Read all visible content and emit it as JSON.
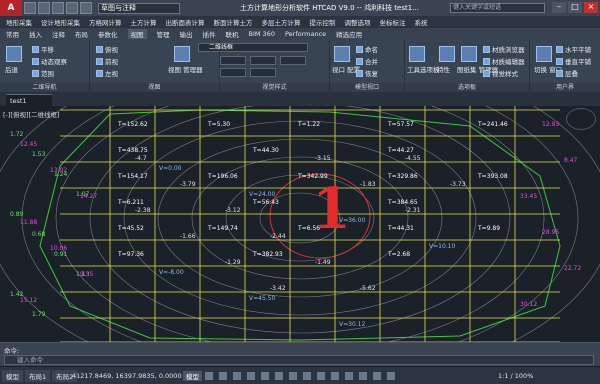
{
  "titlebar": {
    "logo": "A",
    "workspace": "草图与注释",
    "title": "土方计算地形分析软件 HTCAD V9.0 -- 鸿利科技    test1...",
    "search_placeholder": "键入关键字或短语"
  },
  "menubar": [
    "地形采集",
    "设计地形采集",
    "方格网计算",
    "土方计算",
    "出断面表计算",
    "断面计算土方",
    "多层土方计算",
    "提示控制",
    "调整选项",
    "坐标标注",
    "系统"
  ],
  "tabs": [
    "常用",
    "插入",
    "注释",
    "布局",
    "参数化",
    "视图",
    "管理",
    "输出",
    "插件",
    "联机",
    "BIM 360",
    "Performance",
    "精选应用"
  ],
  "ribbon": {
    "panels": [
      "二维导航",
      "视图",
      "视觉样式",
      "模型视口",
      "选项板",
      "用户界面"
    ],
    "nav": {
      "pan": "平移",
      "orbit": "动态观察",
      "extents": "范围",
      "back": "后退"
    },
    "views": [
      "俯视",
      "前视",
      "左视"
    ],
    "view_manager": "视图\n管理器",
    "layer_select": "二维线框",
    "viewport_btns": [
      "命名",
      "合并",
      "恢复"
    ],
    "viewport_config": "视口\n配置",
    "palette": {
      "toolbar": "工具选项板",
      "properties": "特性",
      "sheetset": "图纸集\n管理器"
    },
    "materials": [
      "材质浏览器",
      "材质编辑器",
      "视觉样式"
    ],
    "ui": {
      "switch": "切换\n窗口",
      "tile_h": "水平平铺",
      "tile_v": "垂直平铺",
      "cascade": "层叠",
      "user_interface": "用户界"
    }
  },
  "doc_tab": "test1",
  "canvas": {
    "viewport_label": "[-][俯视][二维线框]",
    "big_label": "1",
    "t_labels": [
      "T=152.62",
      "T=5.30",
      "T=1.22",
      "T=57.57",
      "T=241.46",
      "T=438.75",
      "T=44.30",
      "T=44.27",
      "T=154.17",
      "T=196.06",
      "T=342.99",
      "T=329.86",
      "T=393.08",
      "T=6.211",
      "T=56.43",
      "T=384.65",
      "T=45.52",
      "T=149.74",
      "T=6.56",
      "T=44.31",
      "T=9.89",
      "T=97.36",
      "T=382.93",
      "T=2.68"
    ],
    "h_labels": [
      "-4.7",
      "-3.79",
      "-3.12",
      "-2.44",
      "-1.49",
      "-5.62",
      "-4.55",
      "-3.73",
      "-2.38",
      "-1.66",
      "-1.29",
      "-3.42",
      "-3.15",
      "-1.83",
      "-2.31"
    ],
    "w_labels": [
      "V=0.00",
      "V=24.00",
      "V=36.00",
      "V=10.10",
      "V=-8.00",
      "V=45.50",
      "V=30.12"
    ],
    "green_labels": [
      "1.72",
      "1.53",
      "1.24",
      "1.07",
      "0.89",
      "0.68",
      "0.91",
      "1.13",
      "1.42",
      "1.79"
    ],
    "magenta_labels": [
      "12.45",
      "13.02",
      "14.27",
      "11.88",
      "10.06",
      "9.35",
      "15.12",
      "12.93",
      "8.47",
      "33.45",
      "28.95",
      "22.72",
      "30.12"
    ]
  },
  "command": {
    "history": "命令:",
    "placeholder": "键入命令"
  },
  "status": {
    "layout_tabs": [
      "模型",
      "布局1",
      "布局2"
    ],
    "coords": "41217.8469, 16397.9835, 0.0000",
    "model": "模型",
    "scale": "1:1 / 100%"
  }
}
